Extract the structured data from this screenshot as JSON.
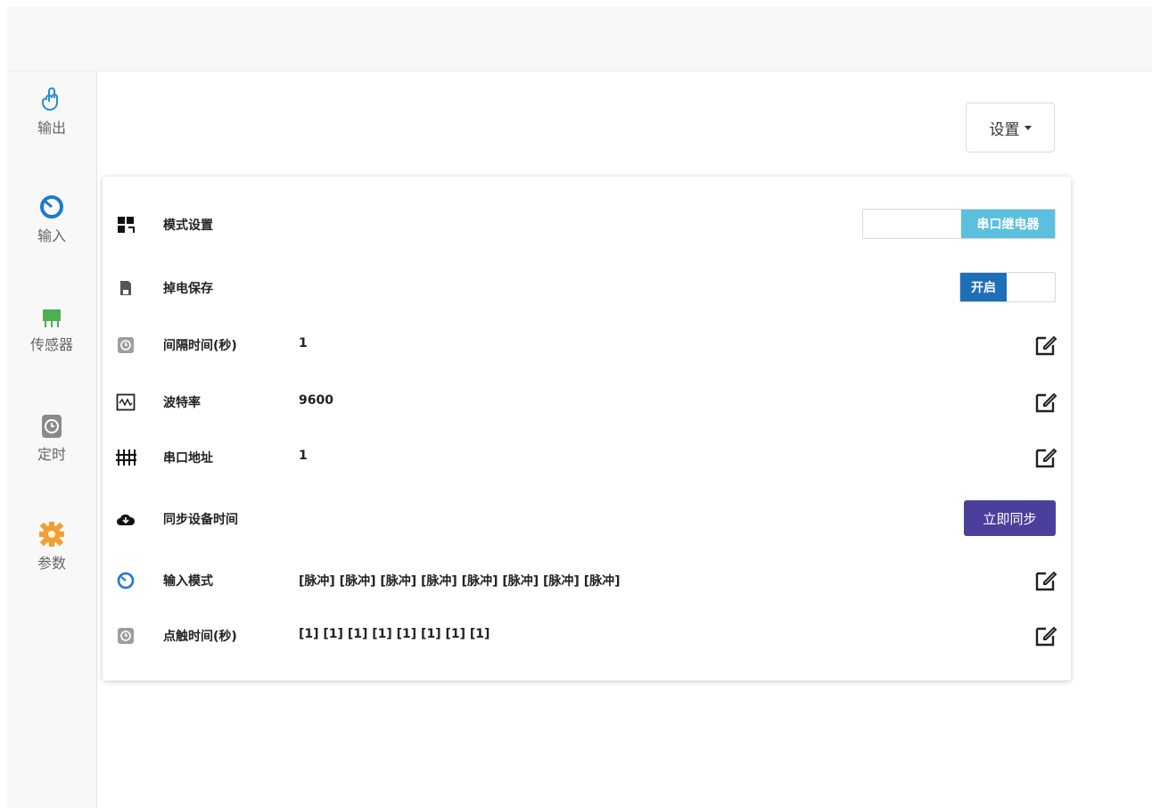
{
  "sidebar": {
    "items": [
      {
        "label": "输出",
        "icon": "touch-icon"
      },
      {
        "label": "输入",
        "icon": "input-ring-icon"
      },
      {
        "label": "传感器",
        "icon": "sensor-icon"
      },
      {
        "label": "定时",
        "icon": "timer-icon"
      },
      {
        "label": "参数",
        "icon": "gear-icon"
      }
    ]
  },
  "header": {
    "settings_label": "设置"
  },
  "settings": {
    "mode": {
      "label": "模式设置",
      "selected": "串口继电器"
    },
    "power_save": {
      "label": "掉电保存",
      "state": "开启"
    },
    "interval": {
      "label": "间隔时间(秒)",
      "value": "1"
    },
    "baud_rate": {
      "label": "波特率",
      "value": "9600"
    },
    "serial_address": {
      "label": "串口地址",
      "value": "1"
    },
    "sync_time": {
      "label": "同步设备时间",
      "button": "立即同步"
    },
    "input_mode": {
      "label": "输入模式",
      "value": "[脉冲] [脉冲] [脉冲] [脉冲] [脉冲] [脉冲] [脉冲] [脉冲]"
    },
    "jog_time": {
      "label": "点触时间(秒)",
      "value": "[1] [1] [1] [1] [1] [1] [1] [1]"
    }
  },
  "colors": {
    "mode_on": "#5bc0de",
    "power_on": "#1f6fb7",
    "sync_button": "#4b3f9c",
    "input_active": "#1e78d0"
  }
}
